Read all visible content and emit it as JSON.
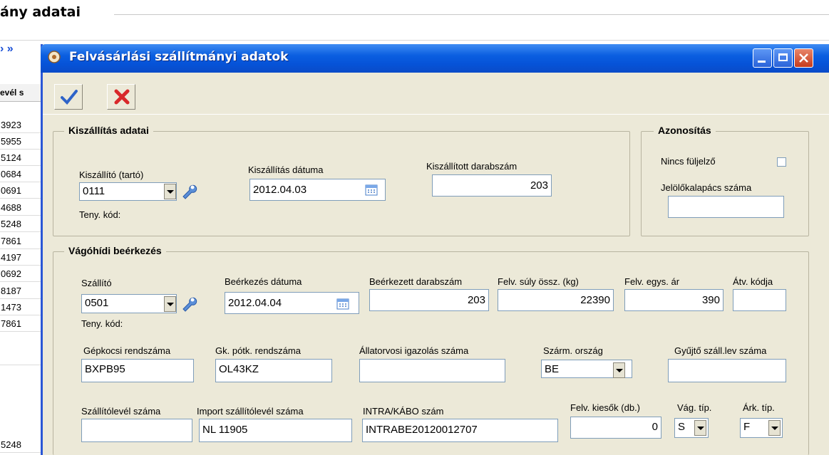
{
  "background_window": {
    "title": "ány adatai",
    "nav_arrows": "›  »",
    "column_header": "evél s",
    "rows": [
      "3923",
      "5955",
      "5124",
      "0684",
      "0691",
      "4688",
      "5248",
      "7861",
      "4197",
      "0692",
      "8187",
      "1473",
      "7861",
      "",
      "5248"
    ]
  },
  "dialog": {
    "title": "Felvásárlási szállítmányi adatok",
    "toolbar": {
      "ok_icon": "checkmark-icon",
      "cancel_icon": "red-x-icon"
    },
    "kiszallitas": {
      "legend": "Kiszállítás adatai",
      "supplier_label": "Kiszállító (tartó)",
      "supplier_value": "0111",
      "teny_kod_label": "Teny. kód:",
      "date_label": "Kiszállítás dátuma",
      "date_value": "2012.04.03",
      "count_label": "Kiszállított darabszám",
      "count_value": "203"
    },
    "azonositas": {
      "legend": "Azonosítás",
      "no_earmark_label": "Nincs füljelző",
      "hammer_label": "Jelölőkalapács száma",
      "hammer_value": ""
    },
    "vagohid": {
      "legend": "Vágóhídi beérkezés",
      "szallito_label": "Szállító",
      "szallito_value": "0501",
      "teny_kod_label": "Teny. kód:",
      "arrival_date_label": "Beérkezés dátuma",
      "arrival_date_value": "2012.04.04",
      "arrived_count_label": "Beérkezett darabszám",
      "arrived_count_value": "203",
      "weight_label": "Felv. súly össz. (kg)",
      "weight_value": "22390",
      "unit_price_label": "Felv. egys. ár",
      "unit_price_value": "390",
      "atv_code_label": "Átv. kódja",
      "atv_code_value": "",
      "plate_label": "Gépkocsi rendszáma",
      "plate_value": "BXPB95",
      "trailer_label": "Gk. pótk. rendszáma",
      "trailer_value": "OL43KZ",
      "vet_label": "Állatorvosi igazolás száma",
      "vet_value": "",
      "country_label": "Szárm. ország",
      "country_value": "BE",
      "collector_label": "Gyűjtő száll.lev száma",
      "collector_value": "",
      "waybill_label": "Szállítólevél száma",
      "waybill_value": "",
      "import_waybill_label": "Import szállítólevél száma",
      "import_waybill_value": "NL 11905",
      "intra_label": "INTRA/KÁBO szám",
      "intra_value": "INTRABE20120012707",
      "dropout_label": "Felv. kiesők (db.)",
      "dropout_value": "0",
      "slaughter_type_label": "Vág. típ.",
      "slaughter_type_value": "S",
      "price_type_label": "Árk. típ.",
      "price_type_value": "F"
    }
  }
}
